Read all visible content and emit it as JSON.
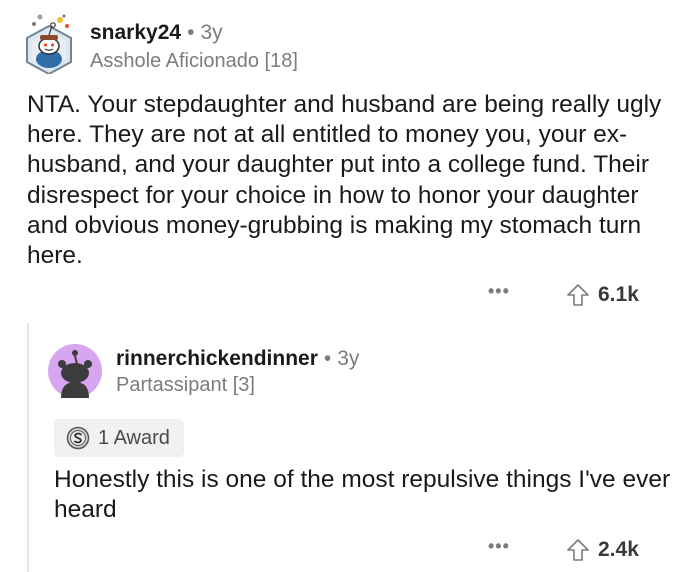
{
  "comment": {
    "author": "snarky24",
    "separator": "•",
    "age": "3y",
    "flair": "Asshole Aficionado [18]",
    "body": "NTA. Your stepdaughter and husband are being really ugly here. They are not at all entitled to money you, your ex-husband, and your daughter put into a college fund. Their disrespect for your choice in how to honor your daughter and obvious money-grubbing is making my stomach turn here.",
    "more_label": "•••",
    "score": "6.1k",
    "avatar_icon": "snoo-avatar-icon",
    "upvote_icon": "upvote-arrow-icon"
  },
  "reply": {
    "author": "rinnerchickendinner",
    "separator": "•",
    "age": "3y",
    "flair": "Partassipant [3]",
    "award_label": "1 Award",
    "award_icon": "silver-award-icon",
    "body": "Honestly this is one of the most repulsive things I've ever heard",
    "more_label": "•••",
    "score": "2.4k",
    "avatar_icon": "snoo-avatar-icon",
    "avatar_color": "#d8a6f0",
    "upvote_icon": "upvote-arrow-icon"
  },
  "colors": {
    "text": "#1a1a1b",
    "meta": "#7c7c7c",
    "thread_line": "#e6e6e6",
    "award_chip": "#f1f1f1"
  }
}
